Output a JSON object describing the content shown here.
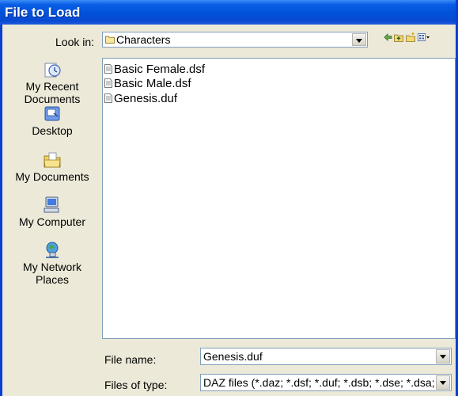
{
  "window": {
    "title": "File to Load"
  },
  "lookin": {
    "label": "Look in:",
    "value": "Characters"
  },
  "places": [
    {
      "label_line1": "My Recent",
      "label_line2": "Documents",
      "icon": "recent-documents-icon"
    },
    {
      "label_line1": "Desktop",
      "label_line2": "",
      "icon": "desktop-icon"
    },
    {
      "label_line1": "My Documents",
      "label_line2": "",
      "icon": "my-documents-icon"
    },
    {
      "label_line1": "My Computer",
      "label_line2": "",
      "icon": "my-computer-icon"
    },
    {
      "label_line1": "My Network",
      "label_line2": "Places",
      "icon": "network-places-icon"
    }
  ],
  "files": [
    {
      "name": "Basic Female.dsf"
    },
    {
      "name": "Basic Male.dsf"
    },
    {
      "name": "Genesis.duf"
    }
  ],
  "filename": {
    "label": "File name:",
    "value": "Genesis.duf"
  },
  "filetype": {
    "label": "Files of type:",
    "value": "DAZ files (*.daz; *.dsf; *.duf; *.dsb; *.dse; *.dsa;"
  },
  "colors": {
    "titlebar": "#0a5fe6",
    "dialog_bg": "#ece9d8",
    "border": "#7f9db9"
  }
}
